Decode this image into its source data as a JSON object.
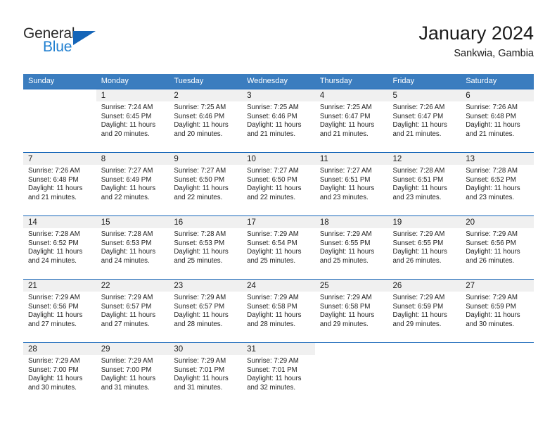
{
  "brand": {
    "word1": "General",
    "word2": "Blue",
    "triangle_color": "#1565b8",
    "blue_color": "#1f7fd0"
  },
  "header": {
    "title": "January 2024",
    "subtitle": "Sankwia, Gambia"
  },
  "theme": {
    "header_row_bg": "#3b7dbf",
    "header_row_text": "#ffffff",
    "row_divider": "#1565b8",
    "daynum_bg": "#f0f0f0"
  },
  "weekdays": [
    "Sunday",
    "Monday",
    "Tuesday",
    "Wednesday",
    "Thursday",
    "Friday",
    "Saturday"
  ],
  "weeks": [
    [
      {
        "day": "",
        "info": ""
      },
      {
        "day": "1",
        "info": "Sunrise: 7:24 AM\nSunset: 6:45 PM\nDaylight: 11 hours\nand 20 minutes."
      },
      {
        "day": "2",
        "info": "Sunrise: 7:25 AM\nSunset: 6:46 PM\nDaylight: 11 hours\nand 20 minutes."
      },
      {
        "day": "3",
        "info": "Sunrise: 7:25 AM\nSunset: 6:46 PM\nDaylight: 11 hours\nand 21 minutes."
      },
      {
        "day": "4",
        "info": "Sunrise: 7:25 AM\nSunset: 6:47 PM\nDaylight: 11 hours\nand 21 minutes."
      },
      {
        "day": "5",
        "info": "Sunrise: 7:26 AM\nSunset: 6:47 PM\nDaylight: 11 hours\nand 21 minutes."
      },
      {
        "day": "6",
        "info": "Sunrise: 7:26 AM\nSunset: 6:48 PM\nDaylight: 11 hours\nand 21 minutes."
      }
    ],
    [
      {
        "day": "7",
        "info": "Sunrise: 7:26 AM\nSunset: 6:48 PM\nDaylight: 11 hours\nand 21 minutes."
      },
      {
        "day": "8",
        "info": "Sunrise: 7:27 AM\nSunset: 6:49 PM\nDaylight: 11 hours\nand 22 minutes."
      },
      {
        "day": "9",
        "info": "Sunrise: 7:27 AM\nSunset: 6:50 PM\nDaylight: 11 hours\nand 22 minutes."
      },
      {
        "day": "10",
        "info": "Sunrise: 7:27 AM\nSunset: 6:50 PM\nDaylight: 11 hours\nand 22 minutes."
      },
      {
        "day": "11",
        "info": "Sunrise: 7:27 AM\nSunset: 6:51 PM\nDaylight: 11 hours\nand 23 minutes."
      },
      {
        "day": "12",
        "info": "Sunrise: 7:28 AM\nSunset: 6:51 PM\nDaylight: 11 hours\nand 23 minutes."
      },
      {
        "day": "13",
        "info": "Sunrise: 7:28 AM\nSunset: 6:52 PM\nDaylight: 11 hours\nand 23 minutes."
      }
    ],
    [
      {
        "day": "14",
        "info": "Sunrise: 7:28 AM\nSunset: 6:52 PM\nDaylight: 11 hours\nand 24 minutes."
      },
      {
        "day": "15",
        "info": "Sunrise: 7:28 AM\nSunset: 6:53 PM\nDaylight: 11 hours\nand 24 minutes."
      },
      {
        "day": "16",
        "info": "Sunrise: 7:28 AM\nSunset: 6:53 PM\nDaylight: 11 hours\nand 25 minutes."
      },
      {
        "day": "17",
        "info": "Sunrise: 7:29 AM\nSunset: 6:54 PM\nDaylight: 11 hours\nand 25 minutes."
      },
      {
        "day": "18",
        "info": "Sunrise: 7:29 AM\nSunset: 6:55 PM\nDaylight: 11 hours\nand 25 minutes."
      },
      {
        "day": "19",
        "info": "Sunrise: 7:29 AM\nSunset: 6:55 PM\nDaylight: 11 hours\nand 26 minutes."
      },
      {
        "day": "20",
        "info": "Sunrise: 7:29 AM\nSunset: 6:56 PM\nDaylight: 11 hours\nand 26 minutes."
      }
    ],
    [
      {
        "day": "21",
        "info": "Sunrise: 7:29 AM\nSunset: 6:56 PM\nDaylight: 11 hours\nand 27 minutes."
      },
      {
        "day": "22",
        "info": "Sunrise: 7:29 AM\nSunset: 6:57 PM\nDaylight: 11 hours\nand 27 minutes."
      },
      {
        "day": "23",
        "info": "Sunrise: 7:29 AM\nSunset: 6:57 PM\nDaylight: 11 hours\nand 28 minutes."
      },
      {
        "day": "24",
        "info": "Sunrise: 7:29 AM\nSunset: 6:58 PM\nDaylight: 11 hours\nand 28 minutes."
      },
      {
        "day": "25",
        "info": "Sunrise: 7:29 AM\nSunset: 6:58 PM\nDaylight: 11 hours\nand 29 minutes."
      },
      {
        "day": "26",
        "info": "Sunrise: 7:29 AM\nSunset: 6:59 PM\nDaylight: 11 hours\nand 29 minutes."
      },
      {
        "day": "27",
        "info": "Sunrise: 7:29 AM\nSunset: 6:59 PM\nDaylight: 11 hours\nand 30 minutes."
      }
    ],
    [
      {
        "day": "28",
        "info": "Sunrise: 7:29 AM\nSunset: 7:00 PM\nDaylight: 11 hours\nand 30 minutes."
      },
      {
        "day": "29",
        "info": "Sunrise: 7:29 AM\nSunset: 7:00 PM\nDaylight: 11 hours\nand 31 minutes."
      },
      {
        "day": "30",
        "info": "Sunrise: 7:29 AM\nSunset: 7:01 PM\nDaylight: 11 hours\nand 31 minutes."
      },
      {
        "day": "31",
        "info": "Sunrise: 7:29 AM\nSunset: 7:01 PM\nDaylight: 11 hours\nand 32 minutes."
      },
      {
        "day": "",
        "info": ""
      },
      {
        "day": "",
        "info": ""
      },
      {
        "day": "",
        "info": ""
      }
    ]
  ]
}
